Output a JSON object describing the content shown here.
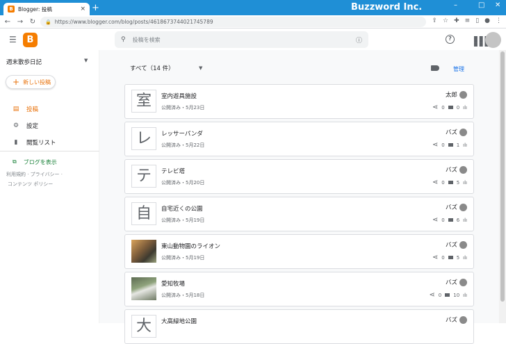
{
  "browser": {
    "tab_title": "Blogger: 投稿",
    "tab_close": "×",
    "new_tab": "+",
    "brand": "Buzzword Inc.",
    "url": "https://www.blogger.com/blog/posts/4618673744021745789",
    "win_min": "–",
    "win_max": "□",
    "win_close": "✕"
  },
  "header": {
    "search_placeholder": "投稿を検索",
    "help": "?"
  },
  "sidebar": {
    "blog_name": "週末散歩日記",
    "new_post": "新しい投稿",
    "items": [
      {
        "label": "投稿",
        "icon": "posts-icon",
        "active": true
      },
      {
        "label": "設定",
        "icon": "gear-icon",
        "active": false
      },
      {
        "label": "閲覧リスト",
        "icon": "bookmark-icon",
        "active": false
      }
    ],
    "view_blog": "ブログを表示",
    "footer_line1": "利用規約 · プライバシー ·",
    "footer_line2": "コンテンツ ポリシー"
  },
  "toolbar": {
    "filter": "すべて（14 件）",
    "manage": "管理"
  },
  "posts": [
    {
      "title": "室内遊具施設",
      "meta": "公開済み・5月23日",
      "author": "太郎",
      "comments": "0",
      "views": "0",
      "thumb": "室",
      "thumb_type": "text"
    },
    {
      "title": "レッサーパンダ",
      "meta": "公開済み・5月22日",
      "author": "バズ",
      "comments": "0",
      "views": "1",
      "thumb": "レ",
      "thumb_type": "text"
    },
    {
      "title": "テレビ塔",
      "meta": "公開済み・5月20日",
      "author": "バズ",
      "comments": "0",
      "views": "5",
      "thumb": "テ",
      "thumb_type": "text"
    },
    {
      "title": "自宅近くの公園",
      "meta": "公開済み・5月19日",
      "author": "バズ",
      "comments": "0",
      "views": "6",
      "thumb": "自",
      "thumb_type": "text"
    },
    {
      "title": "東山動物園のライオン",
      "meta": "公開済み・5月19日",
      "author": "バズ",
      "comments": "0",
      "views": "5",
      "thumb": "",
      "thumb_type": "img1"
    },
    {
      "title": "愛知牧場",
      "meta": "公開済み・5月18日",
      "author": "バズ",
      "comments": "0",
      "views": "10",
      "thumb": "",
      "thumb_type": "img2"
    },
    {
      "title": "大高緑地公園",
      "meta": "",
      "author": "バズ",
      "comments": "",
      "views": "",
      "thumb": "大",
      "thumb_type": "text"
    }
  ],
  "colors": {
    "accent": "#e8710a",
    "brand_bar": "#1f8fd6",
    "link": "#1a73e8",
    "view_blog": "#188038"
  }
}
